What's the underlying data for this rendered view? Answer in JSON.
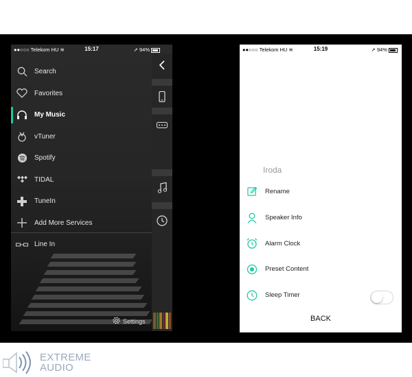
{
  "left_phone": {
    "status": {
      "carrier": "Telekom HU",
      "time": "15:17",
      "battery": "94%"
    },
    "menu": [
      {
        "label": "Search",
        "icon": "search-icon"
      },
      {
        "label": "Favorites",
        "icon": "heart-icon"
      },
      {
        "label": "My Music",
        "icon": "headphones-icon",
        "active": true
      },
      {
        "label": "vTuner",
        "icon": "vtuner-icon"
      },
      {
        "label": "Spotify",
        "icon": "spotify-icon"
      },
      {
        "label": "TIDAL",
        "icon": "tidal-icon"
      },
      {
        "label": "TuneIn",
        "icon": "tunein-icon"
      },
      {
        "label": "Add More Services",
        "icon": "plus-icon"
      },
      {
        "label": "Line In",
        "icon": "line-in-icon"
      }
    ],
    "settings_label": "Settings",
    "accent": "#1ec9a1"
  },
  "right_phone": {
    "status": {
      "carrier": "Telekom HU",
      "time": "15:19",
      "battery": "94%"
    },
    "device_name": "Iroda",
    "menu": [
      {
        "label": "Rename",
        "icon": "edit-icon"
      },
      {
        "label": "Speaker Info",
        "icon": "person-icon"
      },
      {
        "label": "Alarm Clock",
        "icon": "alarm-clock-icon"
      },
      {
        "label": "Preset Content",
        "icon": "preset-icon"
      },
      {
        "label": "Sleep Timer",
        "icon": "sleep-timer-icon",
        "toggle": false
      }
    ],
    "back_label": "BACK",
    "accent": "#1ec9a1"
  },
  "logo": {
    "line1": "EXTREME",
    "line2": "AUDIO"
  }
}
